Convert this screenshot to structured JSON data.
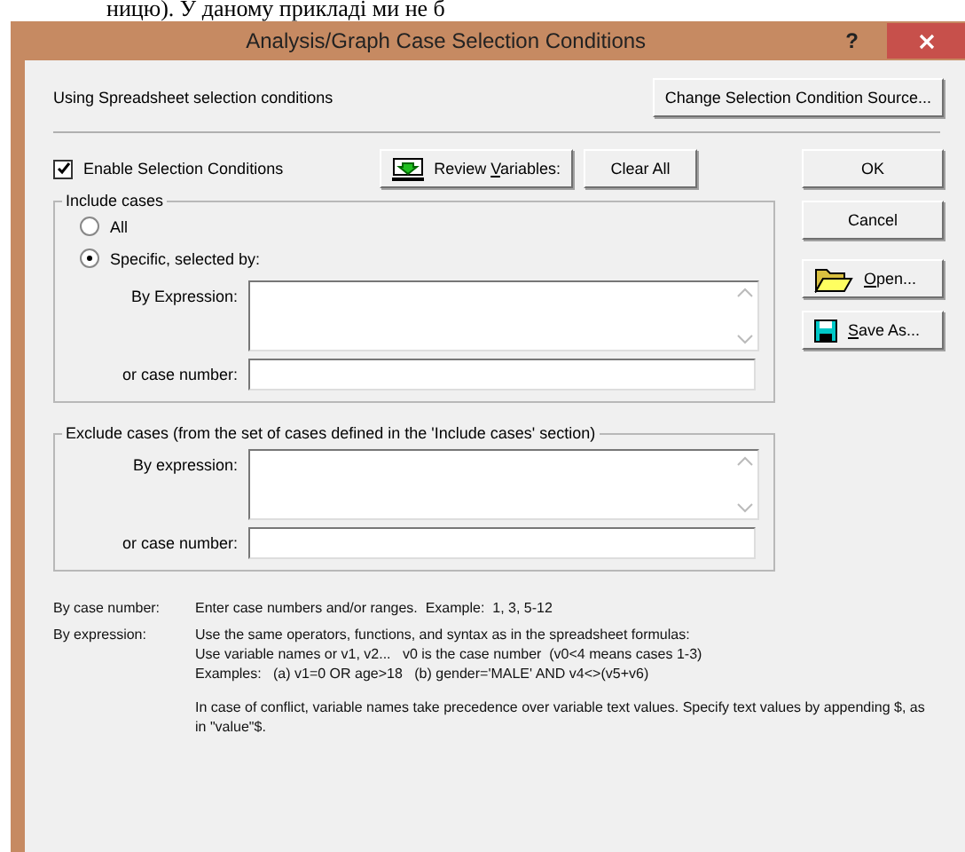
{
  "background_text": "ницю). У даному прикладі ми не б",
  "window": {
    "title": "Analysis/Graph Case Selection Conditions",
    "help": "?"
  },
  "source_label": "Using Spreadsheet selection conditions",
  "change_source_button": "Change Selection Condition Source...",
  "enable": {
    "label": "Enable Selection Conditions",
    "checked": true
  },
  "review_button": {
    "label": "Review ",
    "mnemonic": "V",
    "rest": "ariables:"
  },
  "clear_button": "Clear All",
  "side_buttons": [
    {
      "kind": "ok",
      "label": "OK"
    },
    {
      "kind": "cancel",
      "label": "Cancel"
    },
    {
      "kind": "open",
      "mnemonic": "O",
      "rest": "pen..."
    },
    {
      "kind": "save",
      "mnemonic": "S",
      "rest": "ave As..."
    }
  ],
  "include": {
    "legend": "Include cases",
    "options": [
      {
        "label": "All",
        "selected": false
      },
      {
        "label": "Specific, selected by:",
        "selected": true
      }
    ],
    "expression_label": "By Expression:",
    "number_label": "or case number:"
  },
  "exclude": {
    "legend": "Exclude cases (from the set of cases defined in the 'Include cases' section)",
    "expression_label": "By expression:",
    "number_label": "or case number:"
  },
  "help": [
    {
      "term": "By case number:",
      "lines": [
        "Enter case numbers and/or ranges.  Example:  1, 3, 5-12"
      ]
    },
    {
      "term": "By expression:",
      "lines": [
        "Use the same operators, functions, and syntax as in the spreadsheet formulas:",
        "Use variable names or v1, v2...   v0 is the case number  (v0<4 means cases 1-3)",
        "Examples:   (a) v1=0 OR age>18   (b) gender='MALE' AND v4<>(v5+v6)"
      ]
    }
  ],
  "note": "In case of conflict, variable names take precedence over variable text values. Specify text values by appending $, as in \"value\"$."
}
